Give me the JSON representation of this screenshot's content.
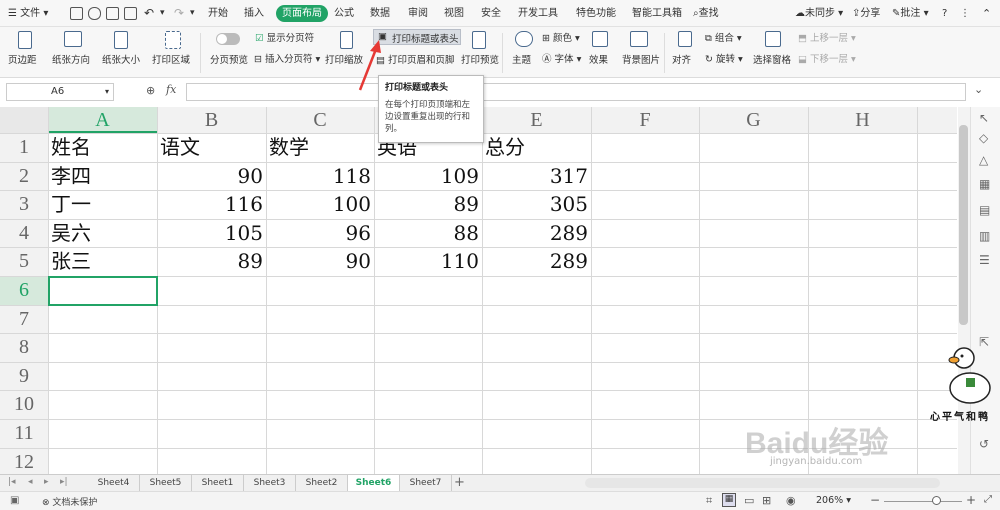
{
  "menubar": {
    "file_label": "文件",
    "items": [
      "开始",
      "插入",
      "页面布局",
      "公式",
      "数据",
      "审阅",
      "视图",
      "安全",
      "开发工具",
      "特色功能",
      "智能工具箱"
    ],
    "active_item": "页面布局",
    "search_label": "查找",
    "sync_label": "未同步",
    "share_label": "分享",
    "comment_label": "批注"
  },
  "ribbon": {
    "margin": "页边距",
    "orientation": "纸张方向",
    "size": "纸张大小",
    "print_area": "打印区域",
    "page_break_preview": "分页预览",
    "show_page_break": "显示分页符",
    "insert_page_break": "插入分页符",
    "print_scale": "打印缩放",
    "print_titles": "打印标题或表头",
    "header_footer": "打印页眉和页脚",
    "print_preview": "打印预览",
    "theme": "主题",
    "colors": "颜色",
    "fonts": "字体",
    "effects": "效果",
    "background": "背景图片",
    "align": "对齐",
    "group": "组合",
    "rotate": "旋转",
    "selection_pane": "选择窗格",
    "bring_forward": "上移一层",
    "send_backward": "下移一层"
  },
  "tooltip": {
    "title": "打印标题或表头",
    "body": "在每个打印页顶端和左边设置重复出现的行和列。"
  },
  "formula_bar": {
    "name_box": "A6",
    "fx": "fx"
  },
  "grid": {
    "columns": [
      "A",
      "B",
      "C",
      "D",
      "E",
      "F",
      "G",
      "H"
    ],
    "rows": [
      "1",
      "2",
      "3",
      "4",
      "5",
      "6",
      "7",
      "8",
      "9",
      "10",
      "11",
      "12"
    ],
    "header_row": [
      "姓名",
      "语文",
      "数学",
      "英语",
      "总分"
    ],
    "data_rows": [
      [
        "李四",
        "90",
        "118",
        "109",
        "317"
      ],
      [
        "丁一",
        "116",
        "100",
        "89",
        "305"
      ],
      [
        "吴六",
        "105",
        "96",
        "88",
        "289"
      ],
      [
        "张三",
        "89",
        "90",
        "110",
        "289"
      ]
    ],
    "selected_cell": "A6"
  },
  "sheet_tabs": [
    "Sheet4",
    "Sheet5",
    "Sheet1",
    "Sheet3",
    "Sheet2",
    "Sheet6",
    "Sheet7"
  ],
  "active_sheet": "Sheet6",
  "status": {
    "protect": "文档未保护",
    "zoom": "206%"
  },
  "watermark": {
    "baidu": "Baidu经验",
    "url": "jingyan.baidu.com",
    "sticker": "心平气和鸭"
  },
  "colors": {
    "accent": "#21a366",
    "arrow": "#e53935"
  }
}
